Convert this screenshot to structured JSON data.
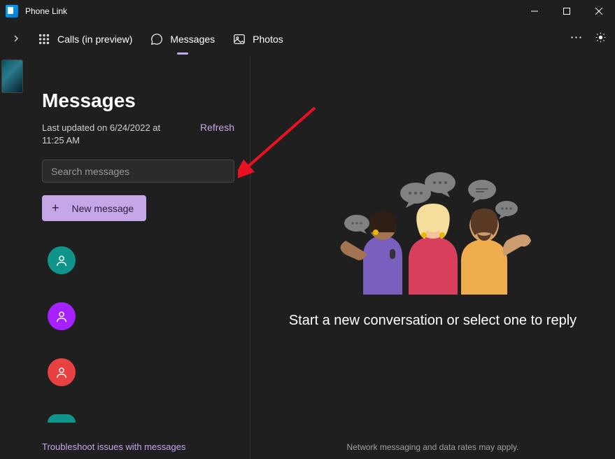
{
  "app": {
    "title": "Phone Link"
  },
  "nav": {
    "calls": "Calls (in preview)",
    "messages": "Messages",
    "photos": "Photos"
  },
  "panel": {
    "heading": "Messages",
    "last_updated": "Last updated on 6/24/2022 at 11:25 AM",
    "refresh": "Refresh",
    "search_placeholder": "Search messages",
    "new_message": "New message",
    "troubleshoot": "Troubleshoot issues with messages"
  },
  "conversations": {
    "avatar_colors": [
      "teal",
      "purple",
      "red"
    ]
  },
  "empty_state": {
    "title": "Start a new conversation or select one to reply",
    "rates": "Network messaging and data rates may apply."
  }
}
